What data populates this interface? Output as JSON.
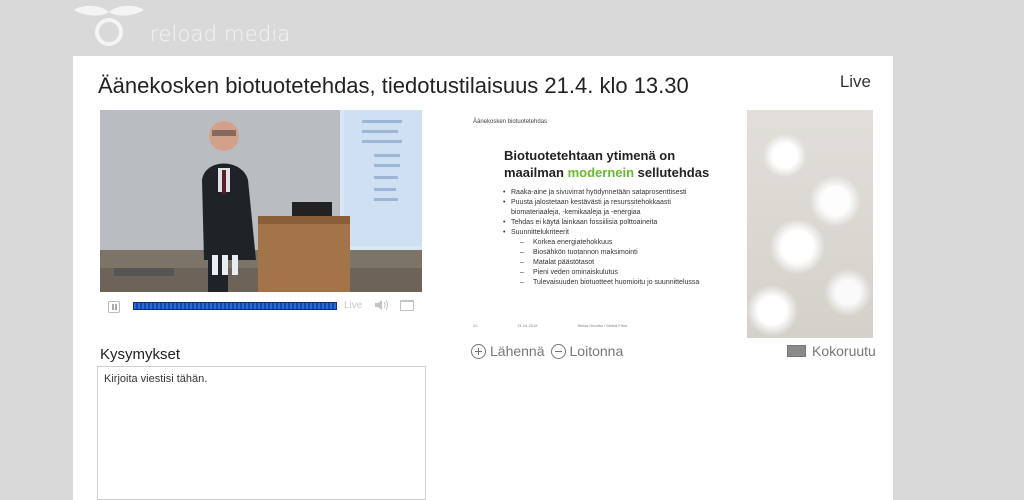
{
  "brand": {
    "name": "reload media"
  },
  "event": {
    "title": "Äänekosken biotuotetehdas, tiedotustilaisuus 21.4. klo 13.30",
    "status": "Live"
  },
  "player": {
    "live_label": "Live"
  },
  "slide": {
    "header": "Äänekosken biotuotetehdas",
    "title_line1": "Biotuotetehtaan ytimenä on",
    "title_line2_prefix": "maailman ",
    "title_line2_accent": "modernein",
    "title_line2_suffix": " sellutehdas",
    "bullets": [
      "Raaka-aine ja sivuvirrat hyödynnetään sataprosenttisesti",
      "Puusta jalostetaan kestävästi ja resurssitehokkaasti",
      "biomateriaaleja, -kemikaaleja ja -energiaa",
      "Tehdas ei käytä lainkaan fossiilisia polttoaineita",
      "Suunnittelukriteerit"
    ],
    "sub_bullets": [
      "Korkea energiatehokkuus",
      "Biosähkön tuotannon maksimointi",
      "Matalat päästötasot",
      "Pieni veden ominaiskulutus",
      "Tulevaisuuden biotuotteet huomioitu jo suunnittelussa"
    ],
    "footer_num": "20",
    "footer_date": "21.04.2015",
    "footer_author": "Niklas Henriks / Metsä Fibre",
    "accent_color": "#6ab82d"
  },
  "zoom": {
    "in_label": "Lähennä",
    "out_label": "Loitonna",
    "fullscreen_label": "Kokoruutu"
  },
  "questions": {
    "label": "Kysymykset",
    "placeholder": "Kirjoita viestisi tähän."
  }
}
